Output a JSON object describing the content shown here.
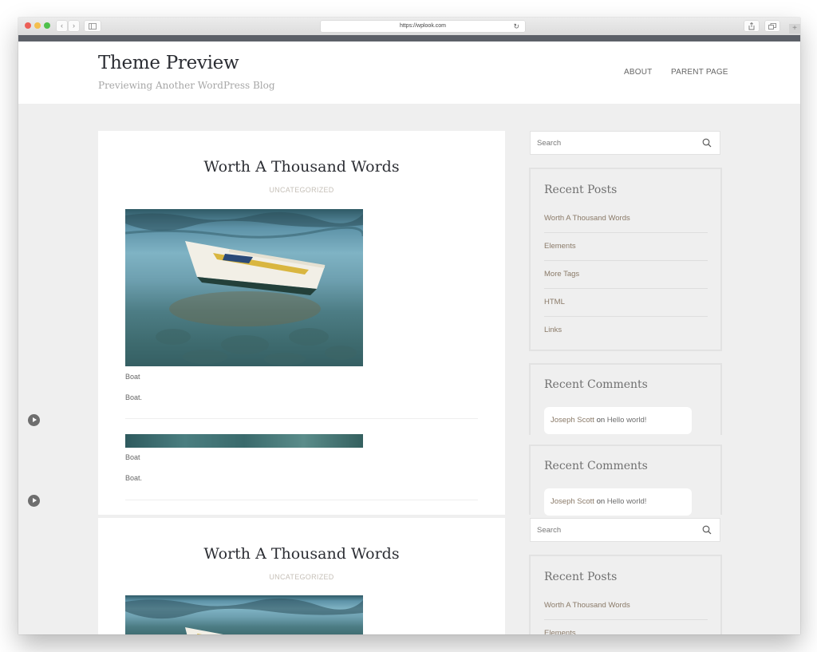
{
  "browser": {
    "url": "https://wplook.com",
    "back_icon": "‹",
    "forward_icon": "›",
    "reload_icon": "↻",
    "new_tab_icon": "+"
  },
  "site": {
    "title": "Theme Preview",
    "tagline": "Previewing Another WordPress Blog",
    "nav": [
      "ABOUT",
      "PARENT PAGE"
    ]
  },
  "posts": [
    {
      "title": "Worth A Thousand Words",
      "category": "UNCATEGORIZED",
      "captions": [
        {
          "title": "Boat",
          "text": "Boat."
        },
        {
          "title": "Boat",
          "text": "Boat."
        }
      ]
    },
    {
      "title": "Worth A Thousand Words",
      "category": "UNCATEGORIZED"
    }
  ],
  "sidebar": {
    "search_placeholder": "Search",
    "recent_posts": {
      "title": "Recent Posts",
      "items": [
        "Worth A Thousand Words",
        "Elements",
        "More Tags",
        "HTML",
        "Links"
      ]
    },
    "recent_comments": {
      "title": "Recent Comments",
      "author": "Joseph Scott",
      "on": "on",
      "post": "Hello world!"
    }
  },
  "colors": {
    "page_bg": "#efefef",
    "title_text": "#2b2d33",
    "link_text": "#8a7a68",
    "dark_bar": "#5c6068"
  }
}
